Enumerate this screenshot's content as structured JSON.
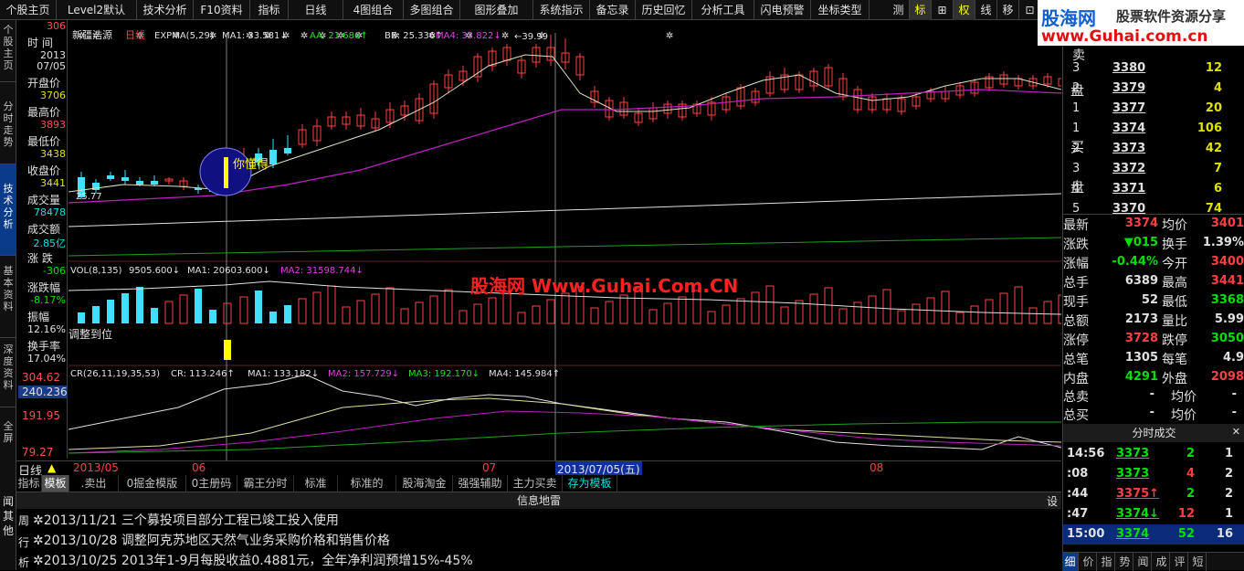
{
  "toolbar": {
    "items": [
      "个股主页",
      "Level2默认",
      "技术分析",
      "F10资料",
      "指标",
      "日线",
      "4图组合",
      "多图组合",
      "图形叠加",
      "系统指示",
      "备忘录",
      "历史回忆",
      "分析工具",
      "闪电预警",
      "坐标类型"
    ],
    "right_items": [
      "测",
      "标",
      "⊞",
      "权",
      "线",
      "移",
      "⊡"
    ]
  },
  "logo": {
    "name": "股海网",
    "slogan": "股票软件资源分享",
    "url": "www.Guhai.com.cn"
  },
  "left_tabs": [
    "个股主页",
    "分时走势",
    "技术分析",
    "基本资料",
    "深度资料",
    "全屏",
    "其他"
  ],
  "info": {
    "time_label": "时 间",
    "time_val1": "2013",
    "time_val2": "07/05",
    "open_label": "开盘价",
    "open_val": "3706",
    "high_label": "最高价",
    "high_val": "3893",
    "low_label": "最低价",
    "low_val": "3438",
    "close_label": "收盘价",
    "close_val": "3441",
    "vol_label": "成交量",
    "vol_val": "78478",
    "amt_label": "成交额",
    "amt_val": "2.85亿",
    "chg_label": "涨 跌",
    "chg_val": "-306",
    "pct_label": "涨跌幅",
    "pct_val": "-8.17%",
    "amp_label": "振幅",
    "amp_val": "12.16%",
    "turn_label": "换手率",
    "turn_val": "17.04%",
    "top_price": "306"
  },
  "chart": {
    "header": "新疆浩源",
    "period": "日线",
    "expma": "EXPMA(5,29)",
    "ma1": "MA1: 33.581↓",
    "aa": "AA: 21.686↑",
    "bb": "BB: 25.336↑",
    "ma4": "MA4: 33.822↓",
    "hi_label": "39.99",
    "lo_label": "25.77",
    "low_marker": "←39.99",
    "vol_header": "VOL(8,135)",
    "vol_v": "9505.600↓",
    "vol_ma1": "MA1: 20603.600↓",
    "vol_ma2": "MA2: 31598.744↓",
    "cr_header": "CR(26,11,19,35,53)",
    "cr_v": "CR: 113.246↑",
    "cr_ma1": "MA1: 133.182↓",
    "cr_ma2": "MA2: 157.729↓",
    "cr_ma3": "MA3: 192.170↓",
    "cr_ma4": "MA4: 145.984↑",
    "cr_y1": "304.62",
    "cr_y2": "240.236",
    "cr_y3": "191.95",
    "cr_y4": "79.27",
    "signal_text": "你懂得",
    "adjust_text": "调整到位",
    "watermark": "股海网 Www.Guhai.Com.CN",
    "date1": "2013/05",
    "date2": "06",
    "date3": "07",
    "date_sel": "2013/07/05(五)",
    "date4": "08"
  },
  "bottom_bar": {
    "period": "日线"
  },
  "tabs": [
    "指标",
    "模板",
    ".卖出",
    "0掘金模版",
    "0主册码",
    "霸王分时",
    "标准",
    "标准的",
    "股海淘金",
    "强强辅助",
    "主力买卖",
    "存为模板"
  ],
  "news": {
    "title": "信息地雷",
    "left": [
      "闻",
      "其",
      "他"
    ],
    "side": [
      "周",
      "行",
      "析"
    ],
    "items": [
      "2013/11/21 三个募投项目部分工程已竣工投入使用",
      "2013/10/28 调整阿克苏地区天然气业务采购价格和销售价格",
      "2013/10/25 2013年1-9月每股收益0.4881元，全年净利润预增15%-45%"
    ],
    "set": "设"
  },
  "orderbook": {
    "sell_label": "卖",
    "pan_label": "盘",
    "buy_label": "买",
    "buy_pan": "盘",
    "sell": [
      {
        "n": "3",
        "p": "3380",
        "v": "12"
      },
      {
        "n": "2",
        "p": "3379",
        "v": "4"
      },
      {
        "n": "1",
        "p": "3377",
        "v": "20"
      }
    ],
    "buy": [
      {
        "n": "1",
        "p": "3374",
        "v": "106"
      },
      {
        "n": "2",
        "p": "3373",
        "v": "42"
      },
      {
        "n": "3",
        "p": "3372",
        "v": "7"
      },
      {
        "n": "4",
        "p": "3371",
        "v": "6"
      },
      {
        "n": "5",
        "p": "3370",
        "v": "74"
      }
    ]
  },
  "quote": [
    {
      "l1": "最新",
      "v1": "3374",
      "l2": "均价",
      "v2": "3401"
    },
    {
      "l1": "涨跌",
      "v1": "▼015",
      "l2": "换手",
      "v2": "1.39%"
    },
    {
      "l1": "涨幅",
      "v1": "-0.44%",
      "l2": "今开",
      "v2": "3400"
    },
    {
      "l1": "总手",
      "v1": "6389",
      "l2": "最高",
      "v2": "3441"
    },
    {
      "l1": "现手",
      "v1": "52",
      "l2": "最低",
      "v2": "3368"
    },
    {
      "l1": "总额",
      "v1": "2173",
      "l2": "量比",
      "v2": "5.99"
    },
    {
      "l1": "涨停",
      "v1": "3728",
      "l2": "跌停",
      "v2": "3050"
    },
    {
      "l1": "总笔",
      "v1": "1305",
      "l2": "每笔",
      "v2": "4.9"
    },
    {
      "l1": "内盘",
      "v1": "4291",
      "l2": "外盘",
      "v2": "2098"
    }
  ],
  "sell_total": {
    "l": "总卖",
    "v": "-",
    "l2": "均价",
    "v2": "-"
  },
  "buy_total": {
    "l": "总买",
    "v": "-",
    "l2": "均价",
    "v2": "-"
  },
  "ticks_title": "分时成交",
  "ticks": [
    {
      "t": "14:56",
      "p": "3373",
      "v": "2",
      "n": "1"
    },
    {
      "t": ":08",
      "p": "3373",
      "v": "4",
      "n": "2"
    },
    {
      "t": ":44",
      "p": "3375↑",
      "v": "2",
      "n": "2"
    },
    {
      "t": ":47",
      "p": "3374↓",
      "v": "12",
      "n": "1"
    },
    {
      "t": "15:00",
      "p": "3374",
      "v": "52",
      "n": "16"
    }
  ],
  "right_tabs": [
    "细",
    "价",
    "指",
    "势",
    "闻",
    "成",
    "评",
    "短"
  ]
}
